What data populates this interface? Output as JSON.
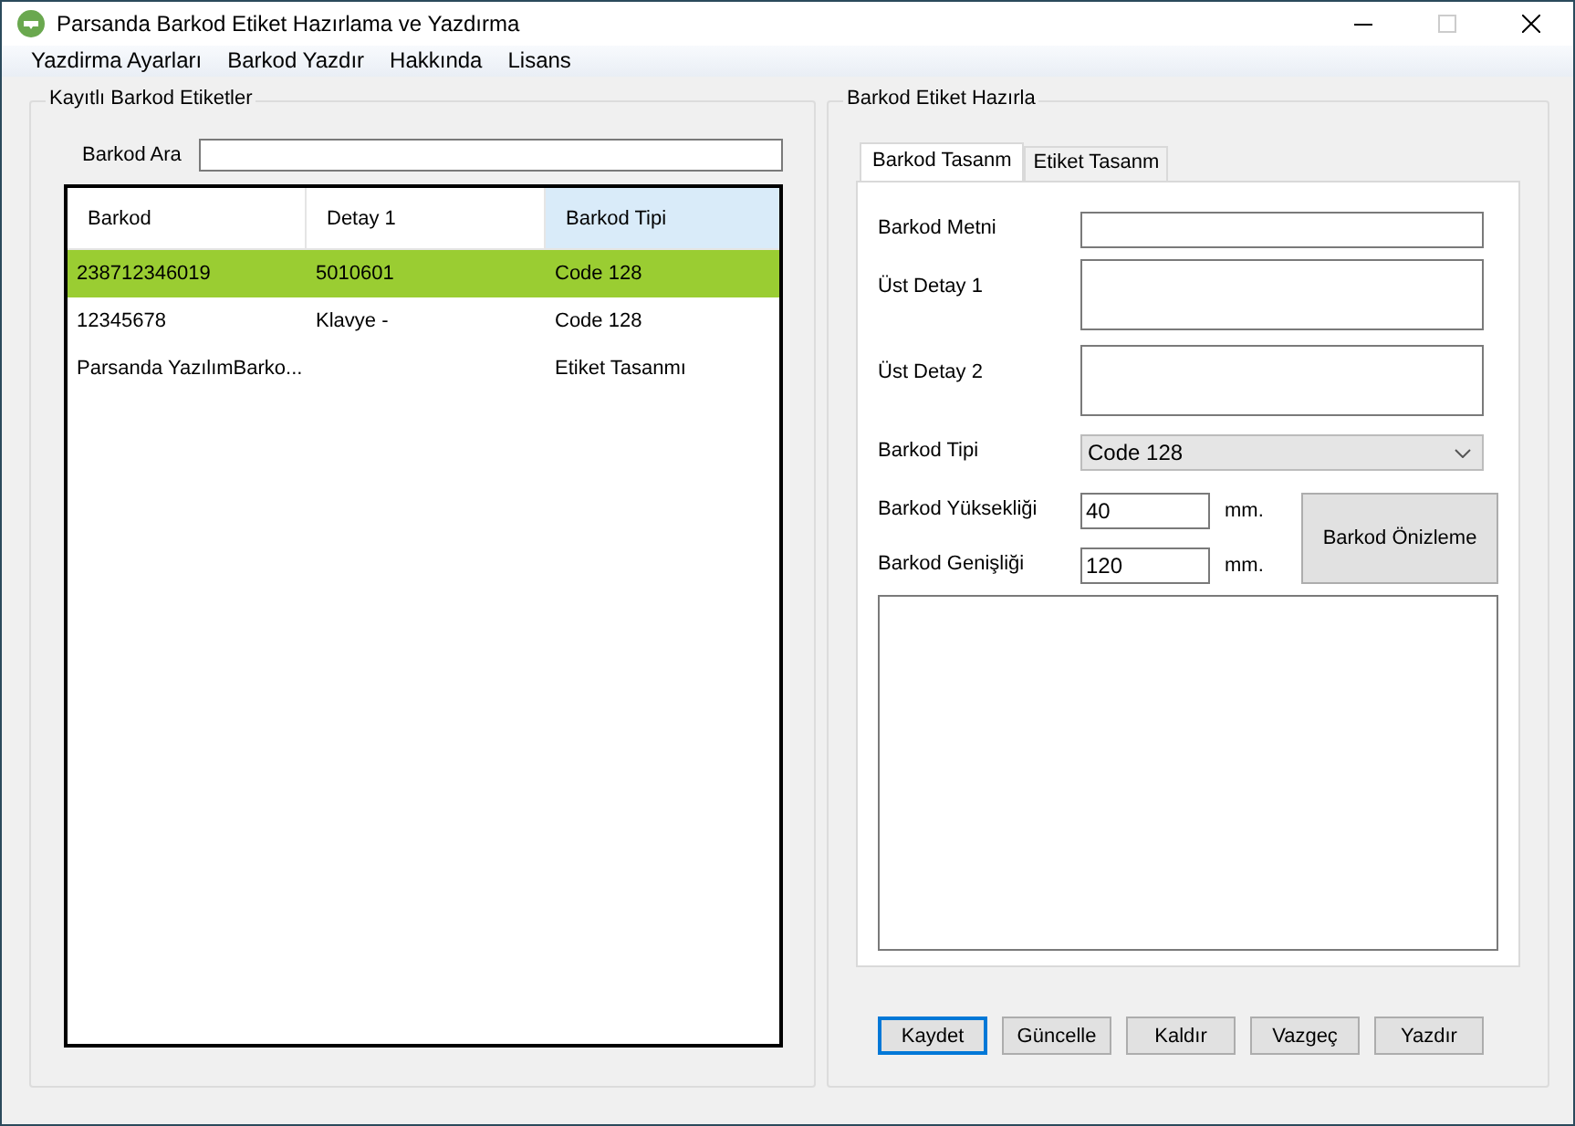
{
  "window": {
    "title": "Parsanda Barkod Etiket Hazırlama ve Yazdırma"
  },
  "menu": [
    "Yazdirma Ayarları",
    "Barkod Yazdır",
    "Hakkında",
    "Lisans"
  ],
  "saved_labels": {
    "title": "Kayıtlı Barkod Etiketler",
    "search": {
      "label": "Barkod Ara"
    },
    "table": {
      "columns": [
        {
          "label": "Barkod",
          "selected": false
        },
        {
          "label": "Detay 1",
          "selected": false
        },
        {
          "label": "Barkod Tipi",
          "selected": true
        }
      ],
      "rows": [
        {
          "cells": [
            "238712346019",
            "5010601",
            "Code 128"
          ],
          "selected": true
        },
        {
          "cells": [
            "12345678",
            "Klavye -",
            "Code 128"
          ],
          "selected": false
        },
        {
          "cells": [
            "Parsanda YazılımBarko...",
            "",
            "Etiket Tasanmı"
          ],
          "selected": false
        }
      ]
    }
  },
  "label_prep": {
    "title": "Barkod Etiket Hazırla",
    "tabs": [
      {
        "label": "Barkod Tasanm",
        "selected": true
      },
      {
        "label": "Etiket Tasanm",
        "selected": false
      }
    ],
    "fields": [
      {
        "kind": "text",
        "label": "Barkod Metni"
      },
      {
        "kind": "textarea",
        "label": "Üst Detay 1"
      },
      {
        "kind": "textarea",
        "label": "Üst Detay 2"
      },
      {
        "kind": "select",
        "label": "Barkod Tipi",
        "value": "Code 128"
      },
      {
        "kind": "size",
        "label": "Barkod Yüksekliği",
        "value": "40",
        "unit": "mm."
      },
      {
        "kind": "size",
        "label": "Barkod Genişliği",
        "value": "120",
        "unit": "mm."
      }
    ],
    "preview_button": "Barkod Önizleme",
    "buttons": [
      {
        "label": "Kaydet",
        "focused": true
      },
      {
        "label": "Güncelle",
        "focused": false
      },
      {
        "label": "Kaldır",
        "focused": false
      },
      {
        "label": "Vazgeç",
        "focused": false
      },
      {
        "label": "Yazdır",
        "focused": false
      }
    ]
  }
}
